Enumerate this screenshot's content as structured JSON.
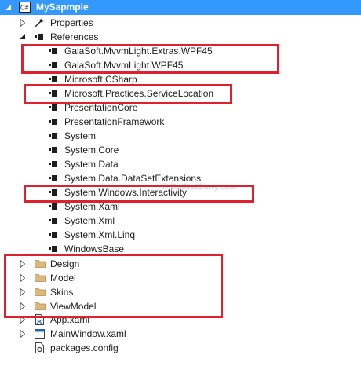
{
  "project": {
    "name": "MySapmple",
    "badge": "C#"
  },
  "nodes": {
    "properties": "Properties",
    "references": "References",
    "app_xaml": "App.xaml",
    "mainwindow_xaml": "MainWindow.xaml",
    "packages_config": "packages.config"
  },
  "references": [
    "GalaSoft.MvvmLight.Extras.WPF45",
    "GalaSoft.MvvmLight.WPF45",
    "Microsoft.CSharp",
    "Microsoft.Practices.ServiceLocation",
    "PresentationCore",
    "PresentationFramework",
    "System",
    "System.Core",
    "System.Data",
    "System.Data.DataSetExtensions",
    "System.Windows.Interactivity",
    "System.Xaml",
    "System.Xml",
    "System.Xml.Linq",
    "WindowsBase"
  ],
  "folders": [
    "Design",
    "Model",
    "Skins",
    "ViewModel"
  ],
  "watermark": "© DotNetCurry.com",
  "colors": {
    "selection": "#3399ff",
    "highlight_box": "#e0202d",
    "folder": "#dcb67a"
  }
}
